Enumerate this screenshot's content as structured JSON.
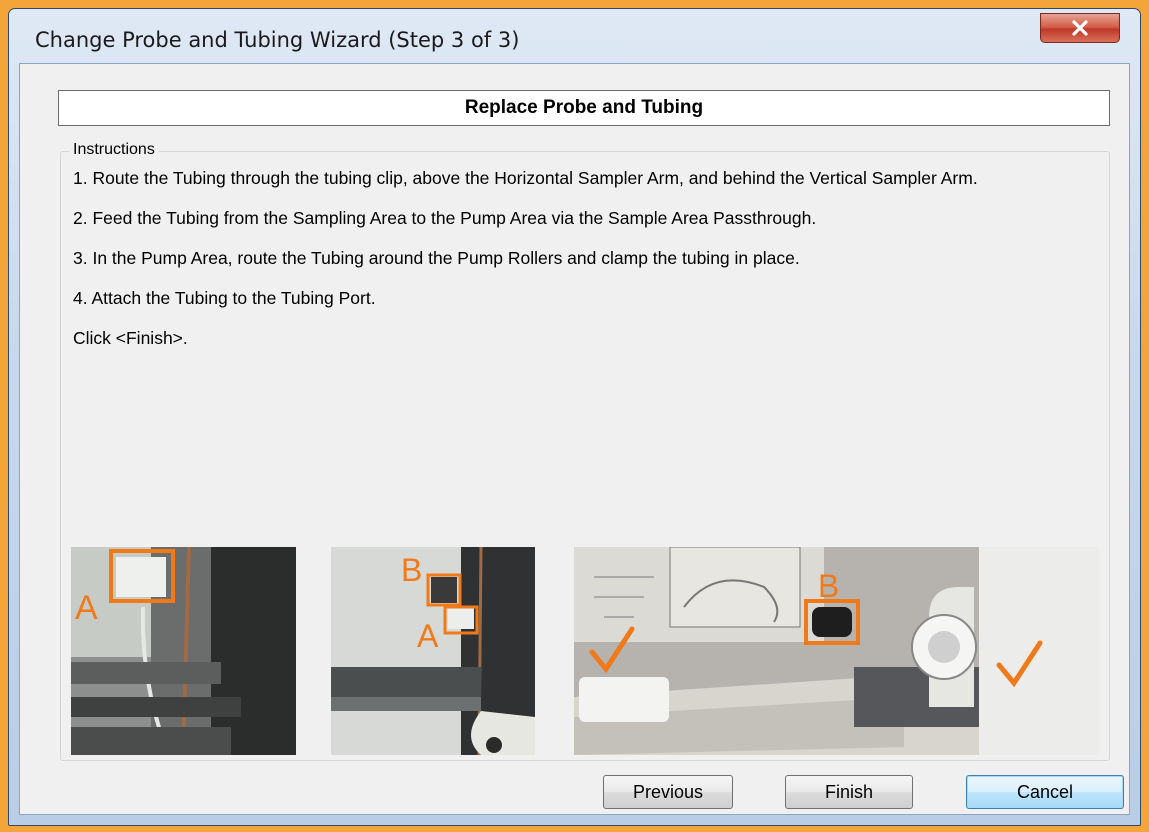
{
  "window": {
    "title": "Change Probe and Tubing Wizard (Step 3 of 3)"
  },
  "header": {
    "text": "Replace Probe and Tubing"
  },
  "instructions": {
    "legend": "Instructions",
    "steps": [
      "1. Route the Tubing through the tubing clip, above the Horizontal Sampler Arm, and behind the Vertical Sampler Arm.",
      "2. Feed the Tubing from the Sampling Area to the Pump Area via the Sample Area Passthrough.",
      "3. In the Pump Area, route the Tubing around the Pump Rollers and clamp the tubing in place.",
      "4. Attach the Tubing to the Tubing Port.",
      "Click <Finish>."
    ]
  },
  "photos": {
    "photo1": {
      "marker_a": "A"
    },
    "photo2": {
      "marker_a": "A",
      "marker_b": "B"
    },
    "photo3": {
      "marker_b": "B"
    }
  },
  "buttons": {
    "previous": "Previous",
    "finish": "Finish",
    "cancel": "Cancel"
  },
  "colors": {
    "annotation": "#f07a1a",
    "frame": "#f4a53a"
  },
  "icons": {
    "close": "close-icon",
    "checkmark": "checkmark-icon"
  }
}
